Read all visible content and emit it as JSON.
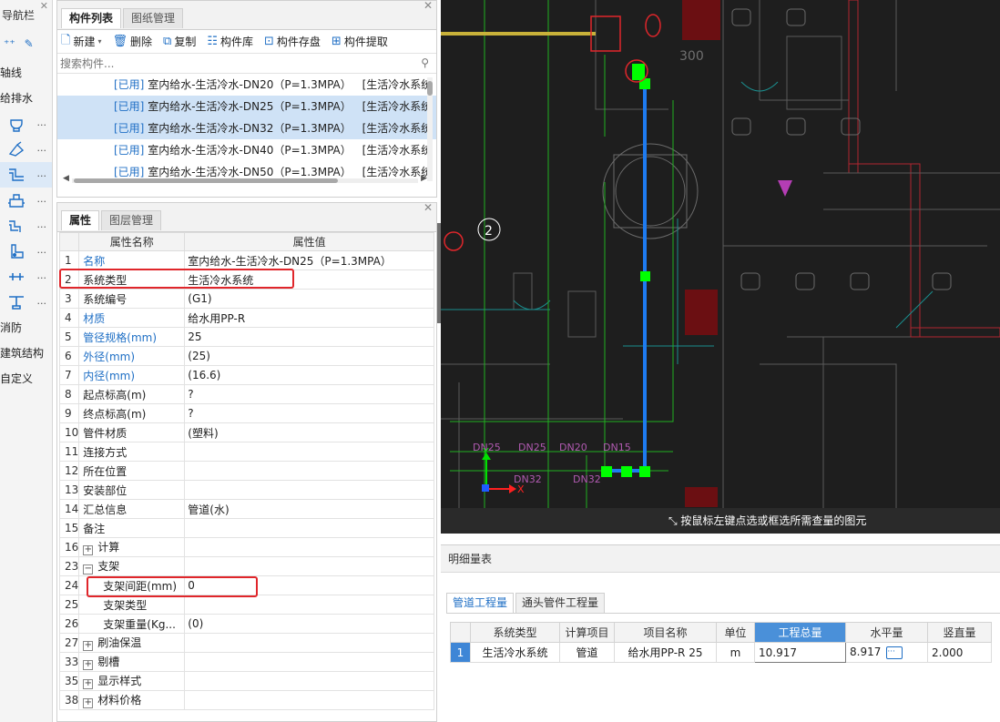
{
  "nav": {
    "title": "导航栏",
    "categories": {
      "axis": "轴线",
      "plumbing": "给排水",
      "fire": "消防",
      "structure": "建筑结构",
      "custom": "自定义"
    },
    "icon_rows": [
      "fixture-icon",
      "valve-icon",
      "pipe-icon",
      "equipment-icon",
      "pipe-fitting-icon",
      "water-meter-icon",
      "sleeve-icon",
      "support-icon"
    ],
    "more": "..."
  },
  "component_panel": {
    "tabs": [
      "构件列表",
      "图纸管理"
    ],
    "toolbar": {
      "new": "新建",
      "delete": "删除",
      "copy": "复制",
      "library": "构件库",
      "save": "构件存盘",
      "extract": "构件提取"
    },
    "search_placeholder": "搜索构件...",
    "items": [
      {
        "status": "[已用]",
        "name": "室内给水-生活冷水-DN20（P=1.3MPA）",
        "system": "[生活冷水系统"
      },
      {
        "status": "[已用]",
        "name": "室内给水-生活冷水-DN25（P=1.3MPA）",
        "system": "[生活冷水系统"
      },
      {
        "status": "[已用]",
        "name": "室内给水-生活冷水-DN32（P=1.3MPA）",
        "system": "[生活冷水系统"
      },
      {
        "status": "[已用]",
        "name": "室内给水-生活冷水-DN40（P=1.3MPA）",
        "system": "[生活冷水系统"
      },
      {
        "status": "[已用]",
        "name": "室内给水-生活冷水-DN50（P=1.3MPA）",
        "system": "[生活冷水系统"
      }
    ]
  },
  "property_panel": {
    "tabs": [
      "属性",
      "图层管理"
    ],
    "header": {
      "name": "属性名称",
      "value": "属性值"
    },
    "rows": [
      {
        "num": "1",
        "name": "名称",
        "value": "室内给水-生活冷水-DN25（P=1.3MPA）"
      },
      {
        "num": "2",
        "name": "系统类型",
        "value": "生活冷水系统"
      },
      {
        "num": "3",
        "name": "系统编号",
        "value": "(G1)"
      },
      {
        "num": "4",
        "name": "材质",
        "value": "给水用PP-R"
      },
      {
        "num": "5",
        "name": "管径规格(mm)",
        "value": "25"
      },
      {
        "num": "6",
        "name": "外径(mm)",
        "value": "(25)"
      },
      {
        "num": "7",
        "name": "内径(mm)",
        "value": "(16.6)"
      },
      {
        "num": "8",
        "name": "起点标高(m)",
        "value": "?"
      },
      {
        "num": "9",
        "name": "终点标高(m)",
        "value": "?"
      },
      {
        "num": "10",
        "name": "管件材质",
        "value": "(塑料)"
      },
      {
        "num": "11",
        "name": "连接方式",
        "value": ""
      },
      {
        "num": "12",
        "name": "所在位置",
        "value": ""
      },
      {
        "num": "13",
        "name": "安装部位",
        "value": ""
      },
      {
        "num": "14",
        "name": "汇总信息",
        "value": "管道(水)"
      },
      {
        "num": "15",
        "name": "备注",
        "value": ""
      },
      {
        "num": "16",
        "name": "计算",
        "value": ""
      },
      {
        "num": "23",
        "name": "支架",
        "value": ""
      },
      {
        "num": "24",
        "name": "支架间距(mm)",
        "value": "0"
      },
      {
        "num": "25",
        "name": "支架类型",
        "value": ""
      },
      {
        "num": "26",
        "name": "支架重量(Kg...",
        "value": "(0)"
      },
      {
        "num": "27",
        "name": "刷油保温",
        "value": ""
      },
      {
        "num": "33",
        "name": "剔槽",
        "value": ""
      },
      {
        "num": "35",
        "name": "显示样式",
        "value": ""
      },
      {
        "num": "38",
        "name": "材料价格",
        "value": ""
      }
    ]
  },
  "cad": {
    "label_2": "2",
    "dim_300": "300",
    "pipe_labels": [
      "DN25",
      "DN25",
      "DN20",
      "DN15",
      "DN32",
      "DN32"
    ],
    "status_text": "按鼠标左键点选或框选所需查量的图元",
    "colors": {
      "background": "#1e1e1e",
      "pipe": "#1e7bf0",
      "wall": "#c0303a",
      "grid": "#20b020",
      "node": "#00ff00"
    }
  },
  "detail": {
    "title": "明细量表",
    "tabs": [
      "管道工程量",
      "通头管件工程量"
    ],
    "columns": [
      "系统类型",
      "计算项目",
      "项目名称",
      "单位",
      "工程总量",
      "水平量",
      "竖直量"
    ],
    "rows": [
      {
        "index": "1",
        "system": "生活冷水系统",
        "item": "管道",
        "name": "给水用PP-R 25",
        "unit": "m",
        "total": "10.917",
        "horizontal": "8.917",
        "vertical": "2.000"
      }
    ],
    "more_btn": "···"
  }
}
